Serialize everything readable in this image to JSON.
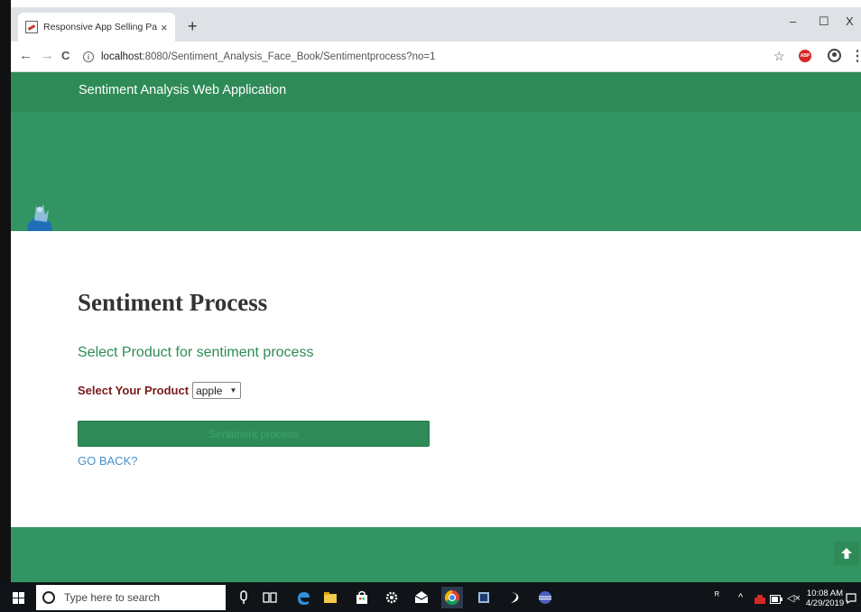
{
  "browser": {
    "tab_title": "Responsive App Selling Page - A",
    "tab_close": "×",
    "new_tab": "+",
    "url_host": "localhost",
    "url_path": ":8080/Sentiment_Analysis_Face_Book/Sentimentprocess?no=1",
    "win_min": "–",
    "win_max": "☐",
    "win_close": "X",
    "back": "←",
    "forward": "→",
    "reload": "C",
    "bookmark": "☆",
    "menu": "⋮",
    "adblock": "ABP"
  },
  "header": {
    "title": "Sentiment Analysis Web Application"
  },
  "main": {
    "heading": "Sentiment Process",
    "subheading": "Select Product for sentiment process",
    "select_label": "Select Your Product",
    "select_value": "apple",
    "process_button": "Sentiment process",
    "go_back": "GO BACK?"
  },
  "taskbar": {
    "search_placeholder": "Type here to search",
    "time": "10:08 AM",
    "date": "4/29/2019"
  },
  "colors": {
    "header_green": "#2e8b57",
    "hero_green": "#339463",
    "label_maroon": "#7a1a1a",
    "link_blue": "#4a90c8"
  }
}
